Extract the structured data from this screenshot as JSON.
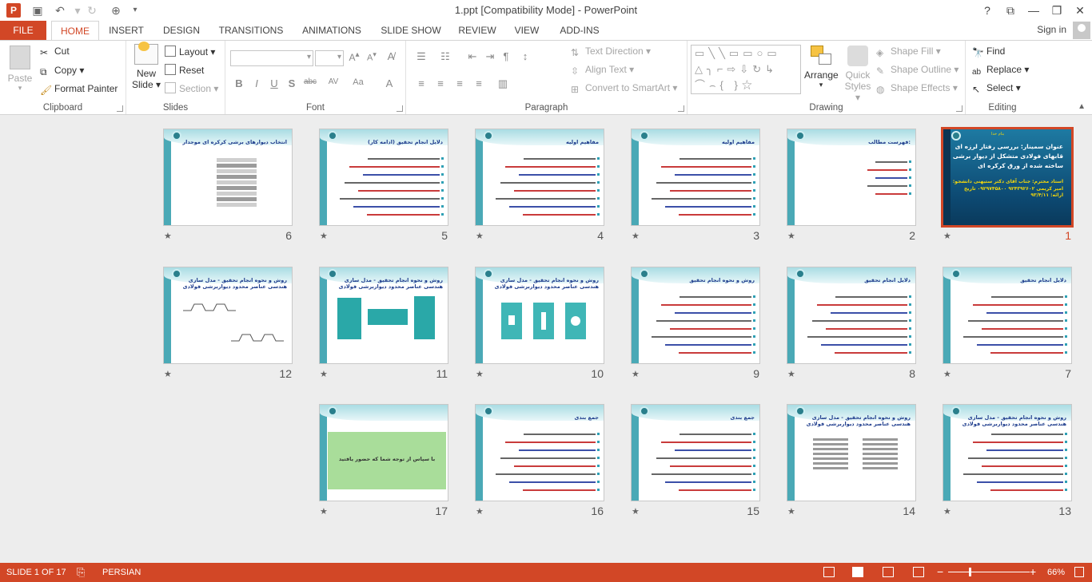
{
  "app": {
    "title": "1.ppt [Compatibility Mode] - PowerPoint",
    "icon_letter": "P",
    "qat": [
      "save-icon",
      "undo-icon",
      "redo-icon",
      "touch-mode-icon",
      "customize-icon"
    ],
    "window_buttons": {
      "help": "?",
      "restore_ribbon": "⧉",
      "minimize": "—",
      "maximize": "❐",
      "close": "✕"
    },
    "signin": "Sign in"
  },
  "tabs": {
    "file": "FILE",
    "items": [
      "HOME",
      "INSERT",
      "DESIGN",
      "TRANSITIONS",
      "ANIMATIONS",
      "SLIDE SHOW",
      "REVIEW",
      "VIEW",
      "ADD-INS"
    ],
    "active": "HOME"
  },
  "ribbon": {
    "clipboard": {
      "label": "Clipboard",
      "paste": "Paste",
      "cut": "Cut",
      "copy": "Copy",
      "format_painter": "Format Painter"
    },
    "slides": {
      "label": "Slides",
      "new_slide": "New Slide",
      "layout": "Layout",
      "reset": "Reset",
      "section": "Section"
    },
    "font": {
      "label": "Font",
      "bold": "B",
      "italic": "I",
      "underline": "U",
      "shadow": "S",
      "strike": "abc",
      "spacing": "AV",
      "case": "Aa",
      "color": "A"
    },
    "paragraph": {
      "label": "Paragraph",
      "text_direction": "Text Direction",
      "align_text": "Align Text",
      "convert_smartart": "Convert to SmartArt"
    },
    "drawing": {
      "label": "Drawing",
      "arrange": "Arrange",
      "quick_styles": "Quick Styles",
      "shape_fill": "Shape Fill",
      "shape_outline": "Shape Outline",
      "shape_effects": "Shape Effects"
    },
    "editing": {
      "label": "Editing",
      "find": "Find",
      "replace": "Replace",
      "select": "Select"
    }
  },
  "slides": [
    {
      "number": "1",
      "type": "cover",
      "top": "بنام خدا",
      "title": "عنوان سمینار: بررسی رفتار لرزه ای قابهای فولادی متشکل از دیوار برشی ساخته شده از ورق کرکره ای",
      "sub": "استاد محترم: جناب آقای دکتر ستیهنی دانشجو: امیر کریمی ۹۲۴۳۹۲۶۰۲ ۰۹۲۹۷۴۵۸۰۰ تاریخ ارائه: ۹۳/۴/۱۱"
    },
    {
      "number": "2",
      "type": "list",
      "title": "فهرست مطالب:"
    },
    {
      "number": "3",
      "type": "text",
      "title": "مفاهیم اولیه"
    },
    {
      "number": "4",
      "type": "text",
      "title": "مفاهیم اولیه"
    },
    {
      "number": "5",
      "type": "text",
      "title": "دلایل انجام تحقیق (ادامه کار)"
    },
    {
      "number": "6",
      "type": "image",
      "title": "انتخاب دیوارهای برشی کرکره ای موجدار"
    },
    {
      "number": "7",
      "type": "text",
      "title": "دلایل انجام تحقیق"
    },
    {
      "number": "8",
      "type": "text",
      "title": "دلایل انجام تحقیق"
    },
    {
      "number": "9",
      "type": "text",
      "title": "روش و نحوه انجام تحقیق"
    },
    {
      "number": "10",
      "type": "image",
      "title": "روش و نحوه انجام تحقیق - مدل سازی هندسی عناصر محدود دیواربرشی فولادی"
    },
    {
      "number": "11",
      "type": "image",
      "title": "روش و نحوه انجام تحقیق - مدل سازی هندسی عناصر محدود دیواربرشی فولادی"
    },
    {
      "number": "12",
      "type": "image",
      "title": "روش و نحوه انجام تحقیق - مدل سازی هندسی عناصر محدود دیواربرشی فولادی"
    },
    {
      "number": "13",
      "type": "text",
      "title": "روش و نحوه انجام تحقیق - مدل سازی هندسی عناصر محدود دیواربرشی فولادی"
    },
    {
      "number": "14",
      "type": "image",
      "title": "روش و نحوه انجام تحقیق - مدل سازی هندسی عناصر محدود دیواربرشی فولادی"
    },
    {
      "number": "15",
      "type": "text",
      "title": "جمع بندی"
    },
    {
      "number": "16",
      "type": "text",
      "title": "جمع بندی"
    },
    {
      "number": "17",
      "type": "thanks",
      "title": "",
      "message": "با سپاس از توجه شما که حضور یافتید"
    }
  ],
  "status": {
    "slide_of": "SLIDE 1 OF 17",
    "language": "PERSIAN",
    "zoom": "66%"
  },
  "colors": {
    "accent": "#d24726",
    "slide_teal": "#4aa9b6"
  }
}
